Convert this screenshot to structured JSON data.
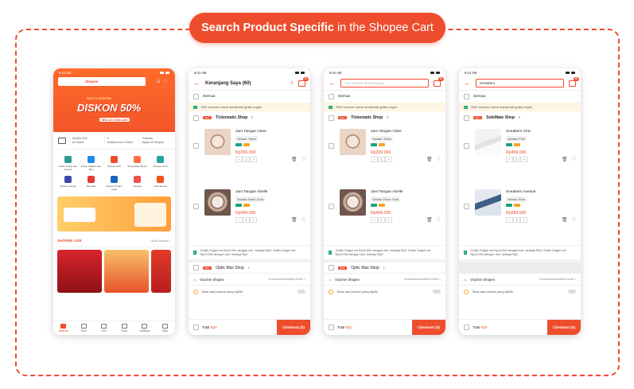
{
  "header": {
    "pre": "Search Product Specific",
    "post": " in the Shopee Cart"
  },
  "home": {
    "time": "9:41 AM",
    "search_brand": "Shopee",
    "promo_top": "SIAP & SHOPEE",
    "promo_main": "DISKON 50%",
    "promo_sub": "MULAI 8 MALAM",
    "wallet": [
      "Rp300.000",
      "0",
      "Transfer"
    ],
    "wallet_sub": [
      "Isi Saldo",
      "Koleksi Koin 10000",
      "Bayar di Tempat"
    ],
    "menu": [
      "Gratis Ongkir dan Voucher",
      "Pulsa, Tagihan dan Tiket",
      "Shopee Mart",
      "ShopeePay Bisnis",
      "Shopee Food",
      "Shopee Games",
      "Berubah",
      "Shopee Pinjam Lebih",
      "Voucher",
      "Lihat Semua"
    ],
    "live_title": "SHOPEE LIVE",
    "live_more": "Lihat Semua >",
    "tabs": [
      "Beranda",
      "Feed",
      "Live",
      "Video",
      "Notifikasi",
      "Saya"
    ]
  },
  "cart1": {
    "time": "9:41 AM",
    "title": "Keranjang Saya (60)",
    "cart_count": "60",
    "semua": "Semua",
    "voucher_bar": "Pilih Voucher untuk menikmati gratis ongkir",
    "shop": "Tickomatic Shop",
    "star": "Star+",
    "items": [
      {
        "name": "Jam Tangan Clare",
        "variant": "Variasi: Silver",
        "price": "Rp399.000",
        "qty": "1"
      },
      {
        "name": "Jam Tangan Abelle",
        "variant": "Variasi: Rose Gold",
        "price": "Rp499.000",
        "qty": "1"
      }
    ],
    "gratis": "Gratis Ongkir s/d Rp10.000 dengan min. belanja Rp0; Gratis Ongkir s/d Rp20.000 dengan min. belanja Rp0",
    "shop2": "Optic Max Shop",
    "voucher_label": "Voucher Shopee",
    "voucher_action": "Gunakan/masukkan kode >",
    "coin_text": "Tidak ada produk yang dipilih",
    "total_label": "Total",
    "total_value": "Rp0",
    "checkout": "Checkout (0)"
  },
  "cart2": {
    "time": "9:41 AM",
    "search_placeholder": "Cari produk di keranjang",
    "cart_count": "60",
    "semua": "Semua",
    "voucher_bar": "Pilih Voucher untuk menikmati gratis ongkir",
    "shop": "Tickomatic Shop",
    "star": "Star+",
    "items": [
      {
        "name": "Jam Tangan Clare",
        "variant": "Variasi: Silver",
        "price": "Rp399.000",
        "qty": "1"
      },
      {
        "name": "Jam Tangan Abelle",
        "variant": "Variasi: Rose Gold",
        "price": "Rp499.000",
        "qty": "1"
      }
    ],
    "gratis": "Gratis Ongkir s/d Rp10.000 dengan min. belanja Rp0; Gratis Ongkir s/d Rp20.000 dengan min. belanja Rp0",
    "shop2": "Optic Max Shop",
    "voucher_label": "Voucher Shopee",
    "voucher_action": "Gunakan/masukkan kode >",
    "coin_text": "Tidak ada produk yang dipilih",
    "total_label": "Total",
    "total_value": "Rp0",
    "checkout": "Checkout (0)"
  },
  "cart3": {
    "time": "9:41 AM",
    "search_value": "Sneakers",
    "cart_count": "60",
    "semua": "Semua",
    "voucher_bar": "Pilih Voucher untuk menikmati gratis ongkir",
    "shop": "SoleMate Shop",
    "star": "Star+",
    "items": [
      {
        "name": "Sneakers Chic",
        "variant": "Variasi: Pink",
        "price": "Rp499.000",
        "qty": "1"
      },
      {
        "name": "Sneakers Avenue",
        "variant": "Variasi: Blue",
        "price": "Rp589.000",
        "qty": "1"
      }
    ],
    "gratis": "Gratis Ongkir s/d Rp10.000 dengan min. belanja Rp0; Gratis Ongkir s/d Rp20.000 dengan min. belanja Rp0",
    "voucher_label": "Voucher Shopee",
    "voucher_action": "Gunakan/masukkan kode >",
    "coin_text": "Tidak ada produk yang dipilih",
    "total_label": "Total",
    "total_value": "Rp0",
    "checkout": "Checkout (0)"
  },
  "colors": {
    "accent": "#ee4d2d",
    "voucher_bg": "#fdf5e1",
    "free_ship": "#1aa37a"
  }
}
